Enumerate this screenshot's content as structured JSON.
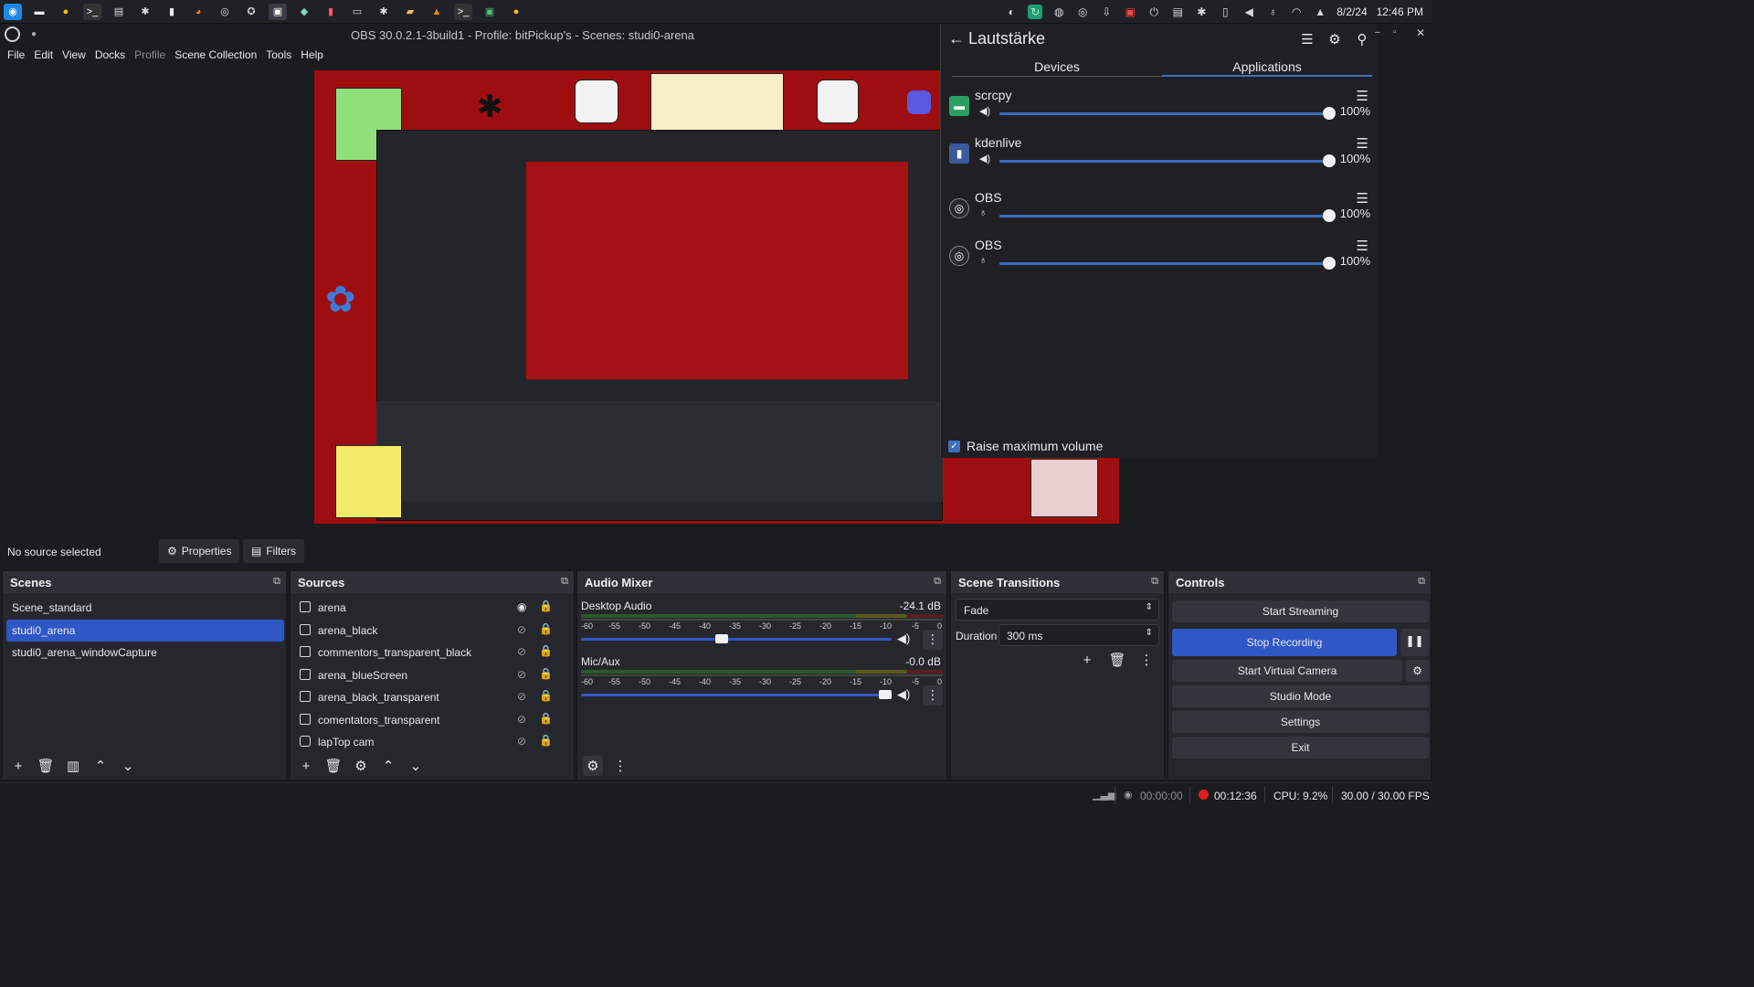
{
  "window": {
    "title": "OBS 30.0.2.1-3build1 - Profile: bitPickup's - Scenes: studi0-arena"
  },
  "taskbar": {
    "date": "8/2/24",
    "time": "12:46 PM"
  },
  "menu": [
    "File",
    "Edit",
    "View",
    "Docks",
    "Profile",
    "Scene Collection",
    "Tools",
    "Help"
  ],
  "volume_panel": {
    "title": "Lautstärke",
    "tabs": [
      "Devices",
      "Applications"
    ],
    "apps": [
      {
        "name": "scrcpy",
        "percent": "100%"
      },
      {
        "name": "kdenlive",
        "percent": "100%"
      },
      {
        "name": "OBS",
        "percent": "100%"
      },
      {
        "name": "OBS",
        "percent": "100%"
      }
    ],
    "raise_max_label": "Raise maximum volume"
  },
  "source_toolbar": {
    "status": "No source selected",
    "properties": "Properties",
    "filters": "Filters"
  },
  "scenes": {
    "title": "Scenes",
    "items": [
      "Scene_standard",
      "studi0_arena",
      "studi0_arena_windowCapture"
    ],
    "selected_index": 1
  },
  "sources": {
    "title": "Sources",
    "items": [
      {
        "name": "arena",
        "visible": true
      },
      {
        "name": "arena_black",
        "visible": false
      },
      {
        "name": "commentors_transparent_black",
        "visible": false
      },
      {
        "name": "arena_blueScreen",
        "visible": false
      },
      {
        "name": "arena_black_transparent",
        "visible": false
      },
      {
        "name": "comentators_transparent",
        "visible": false
      },
      {
        "name": "lapTop cam",
        "visible": false
      }
    ]
  },
  "audio_mixer": {
    "title": "Audio Mixer",
    "scale": [
      "-60",
      "-55",
      "-50",
      "-45",
      "-40",
      "-35",
      "-30",
      "-25",
      "-20",
      "-15",
      "-10",
      "-5",
      "0"
    ],
    "channels": [
      {
        "name": "Desktop Audio",
        "db": "-24.1 dB",
        "level": 0.45
      },
      {
        "name": "Mic/Aux",
        "db": "-0.0 dB",
        "level": 1.0
      }
    ]
  },
  "scene_transitions": {
    "title": "Scene Transitions",
    "transition": "Fade",
    "duration_label": "Duration",
    "duration_value": "300 ms"
  },
  "controls": {
    "title": "Controls",
    "start_streaming": "Start Streaming",
    "stop_recording": "Stop Recording",
    "start_virtual_camera": "Start Virtual Camera",
    "studio_mode": "Studio Mode",
    "settings": "Settings",
    "exit": "Exit"
  },
  "status_bar": {
    "stream_time": "00:00:00",
    "rec_time": "00:12:36",
    "cpu": "CPU: 9.2%",
    "fps": "30.00 / 30.00 FPS"
  },
  "colors": {
    "accent": "#2f57c6",
    "preview_red": "#9e0e10",
    "rec_red": "#e02020"
  }
}
